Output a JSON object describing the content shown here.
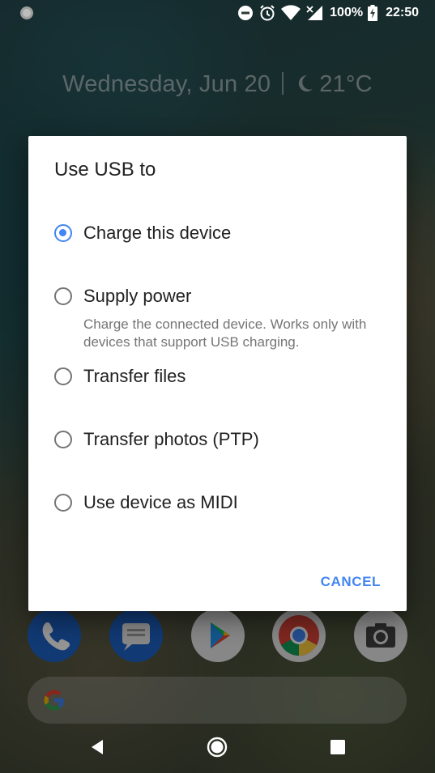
{
  "status_bar": {
    "battery_percent": "100%",
    "time": "22:50",
    "icons": [
      "notification-dot-icon",
      "do-not-disturb-icon",
      "alarm-icon",
      "wifi-icon",
      "no-signal-icon",
      "battery-charging-icon"
    ]
  },
  "home": {
    "date": "Wednesday, Jun 20",
    "weather_temp": "21°C",
    "weather_icon": "moon-icon",
    "dock": [
      "phone-app-icon",
      "messages-app-icon",
      "play-store-app-icon",
      "chrome-app-icon",
      "camera-app-icon"
    ],
    "search_icon": "google-g-icon"
  },
  "dialog": {
    "title": "Use USB to",
    "options": [
      {
        "label": "Charge this device",
        "selected": true
      },
      {
        "label": "Supply power",
        "subtitle": "Charge the connected device. Works only with devices that support USB charging.",
        "selected": false
      },
      {
        "label": "Transfer files",
        "selected": false
      },
      {
        "label": "Transfer photos (PTP)",
        "selected": false
      },
      {
        "label": "Use device as MIDI",
        "selected": false
      }
    ],
    "cancel_label": "CANCEL"
  },
  "nav_bar": {
    "icons": [
      "back-icon",
      "home-icon",
      "recents-icon"
    ]
  },
  "colors": {
    "accent": "#4285f4",
    "dialog_bg": "#ffffff",
    "text_primary": "#212121",
    "text_secondary": "#757575"
  }
}
